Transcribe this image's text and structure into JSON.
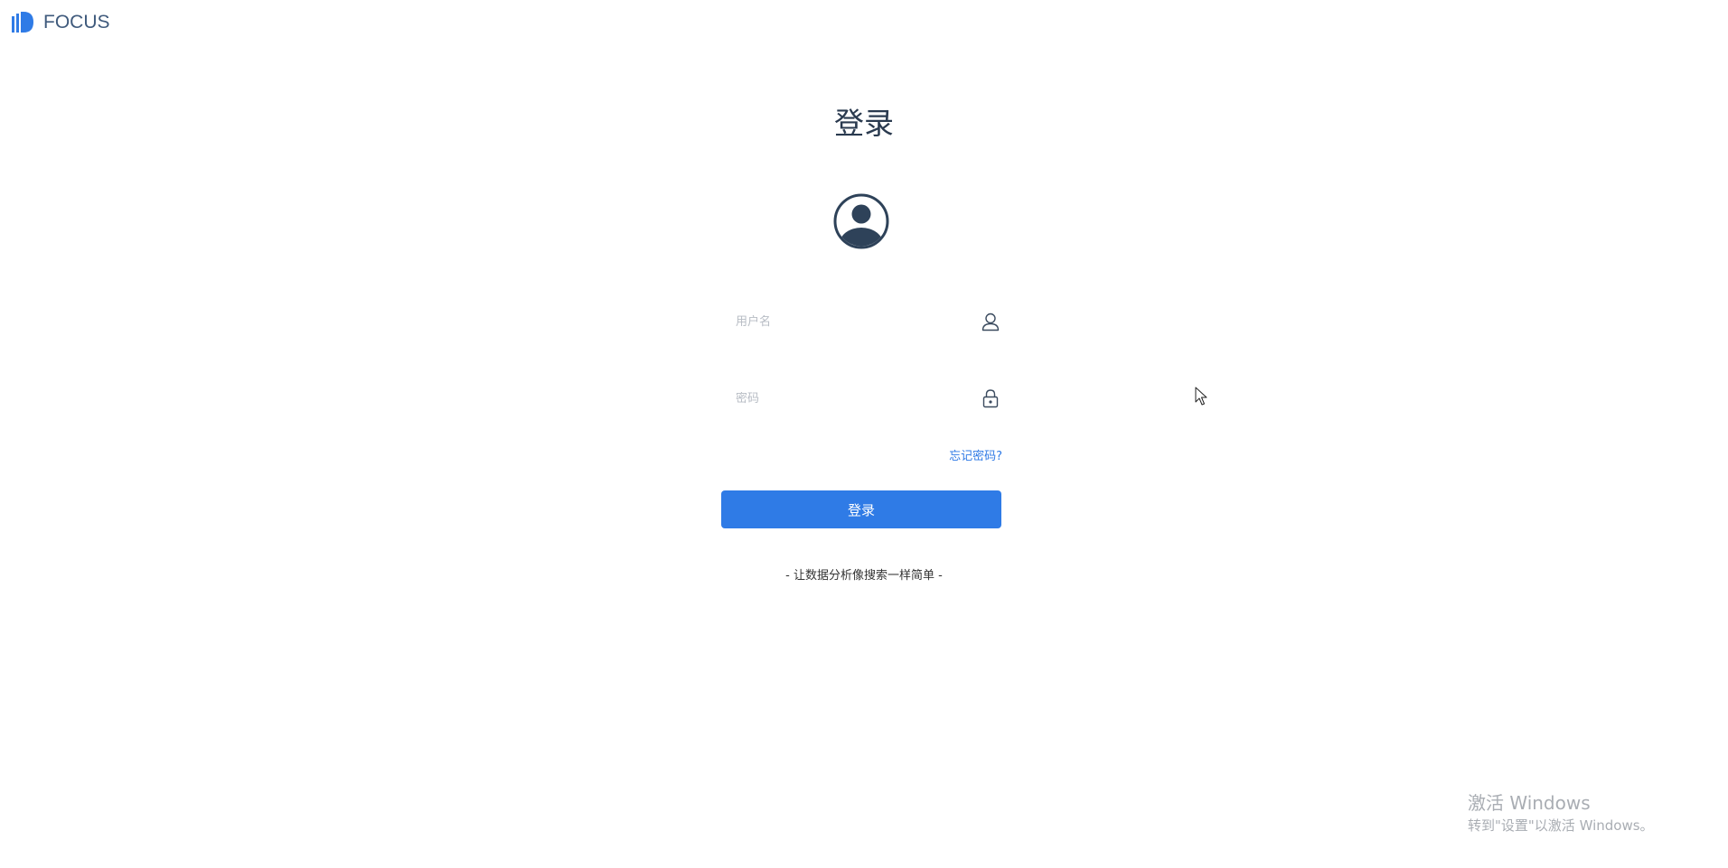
{
  "brand": {
    "name": "FOCUS",
    "logo_icon": "focus-bars-logo",
    "color": "#2f7be6"
  },
  "login": {
    "title": "登录",
    "avatar_icon": "user-circle-icon",
    "username_placeholder": "用户名",
    "username_value": "",
    "username_icon": "user-icon",
    "password_placeholder": "密码",
    "password_value": "",
    "password_icon": "lock-icon",
    "forgot_label": "忘记密码?",
    "submit_label": "登录",
    "tagline": "- 让数据分析像搜索一样简单 -",
    "accent_color": "#2f7be6"
  },
  "watermark": {
    "title": "激活 Windows",
    "subtitle": "转到\"设置\"以激活 Windows。"
  }
}
